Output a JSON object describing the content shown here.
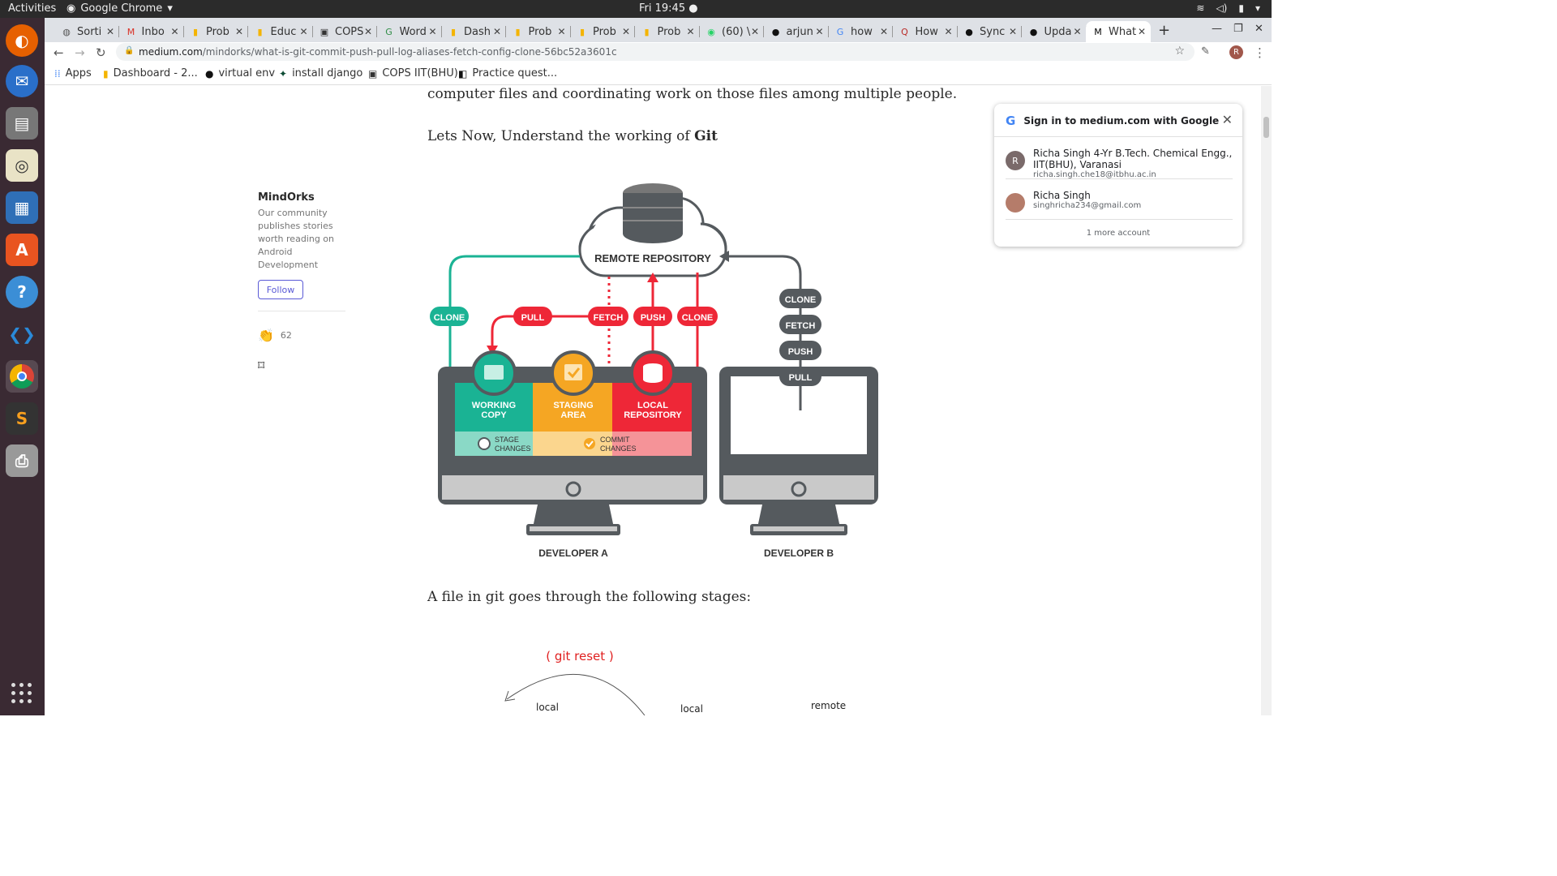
{
  "system_bar": {
    "activities": "Activities",
    "app_name": "Google Chrome",
    "clock": "Fri 19:45"
  },
  "tabs": [
    {
      "label": "Sorti",
      "icon": "globe-icon"
    },
    {
      "label": "Inbo",
      "icon": "gmail-icon"
    },
    {
      "label": "Prob",
      "icon": "chart-icon"
    },
    {
      "label": "Educ",
      "icon": "chart-icon"
    },
    {
      "label": "COPS",
      "icon": "cops-icon"
    },
    {
      "label": "Word",
      "icon": "gfg-icon"
    },
    {
      "label": "Dash",
      "icon": "chart-icon"
    },
    {
      "label": "Prob",
      "icon": "chart-icon"
    },
    {
      "label": "Prob",
      "icon": "chart-icon"
    },
    {
      "label": "Prob",
      "icon": "chart-icon"
    },
    {
      "label": "(60) \\",
      "icon": "whatsapp-icon"
    },
    {
      "label": "arjun",
      "icon": "github-icon"
    },
    {
      "label": "how",
      "icon": "google-icon"
    },
    {
      "label": "How",
      "icon": "quora-icon"
    },
    {
      "label": "Sync",
      "icon": "github-icon"
    },
    {
      "label": "Upda",
      "icon": "github-icon"
    },
    {
      "label": "What",
      "icon": "medium-icon",
      "active": true
    }
  ],
  "omnibox": {
    "domain": "medium.com",
    "path": "/mindorks/what-is-git-commit-push-pull-log-aliases-fetch-config-clone-56bc52a3601c"
  },
  "bookmarks": [
    {
      "label": "Apps",
      "icon": "apps-grid-icon"
    },
    {
      "label": "Dashboard - 2...",
      "icon": "chart-icon"
    },
    {
      "label": "virtual env",
      "icon": "github-icon"
    },
    {
      "label": "install django",
      "icon": "django-icon"
    },
    {
      "label": "COPS IIT(BHU)",
      "icon": "cops-icon"
    },
    {
      "label": "Practice quest...",
      "icon": "hackerrank-icon"
    }
  ],
  "profile_initial": "R",
  "article": {
    "para1": "computer files and coordinating work on those files among multiple people.",
    "para2_prefix": "Lets Now, Understand the working of ",
    "para2_bold": "Git",
    "para3": "A file in git goes through the following stages:"
  },
  "sidebar": {
    "publication": "MindOrks",
    "description": "Our community publishes stories worth reading on Android Development",
    "follow": "Follow",
    "claps": "62"
  },
  "diagram": {
    "remote": "REMOTE REPOSITORY",
    "clone_left": "CLONE",
    "pull": "PULL",
    "fetch": "FETCH",
    "push": "PUSH",
    "clone_right": "CLONE",
    "b_clone": "CLONE",
    "b_fetch": "FETCH",
    "b_push": "PUSH",
    "b_pull": "PULL",
    "working_copy_1": "WORKING",
    "working_copy_2": "COPY",
    "staging_1": "STAGING",
    "staging_2": "AREA",
    "local_1": "LOCAL",
    "local_2": "REPOSITORY",
    "stage_changes_1": "STAGE",
    "stage_changes_2": "CHANGES",
    "commit_changes_1": "COMMIT",
    "commit_changes_2": "CHANGES",
    "dev_a": "DEVELOPER A",
    "dev_b": "DEVELOPER B"
  },
  "sketch": {
    "reset": "( git reset )",
    "local1": "local",
    "local2": "local",
    "remote": "remote"
  },
  "signin_popup": {
    "title": "Sign in to medium.com with Google",
    "accounts": [
      {
        "initial": "R",
        "name": "Richa Singh 4-Yr B.Tech. Chemical Engg., IIT(BHU), Varanasi",
        "email": "richa.singh.che18@itbhu.ac.in"
      },
      {
        "initial": "",
        "name": "Richa Singh",
        "email": "singhricha234@gmail.com"
      }
    ],
    "more": "1 more account"
  },
  "colors": {
    "green": "#1ab394",
    "orange": "#f5a623",
    "red": "#ee2737",
    "gray": "#555a5e"
  }
}
